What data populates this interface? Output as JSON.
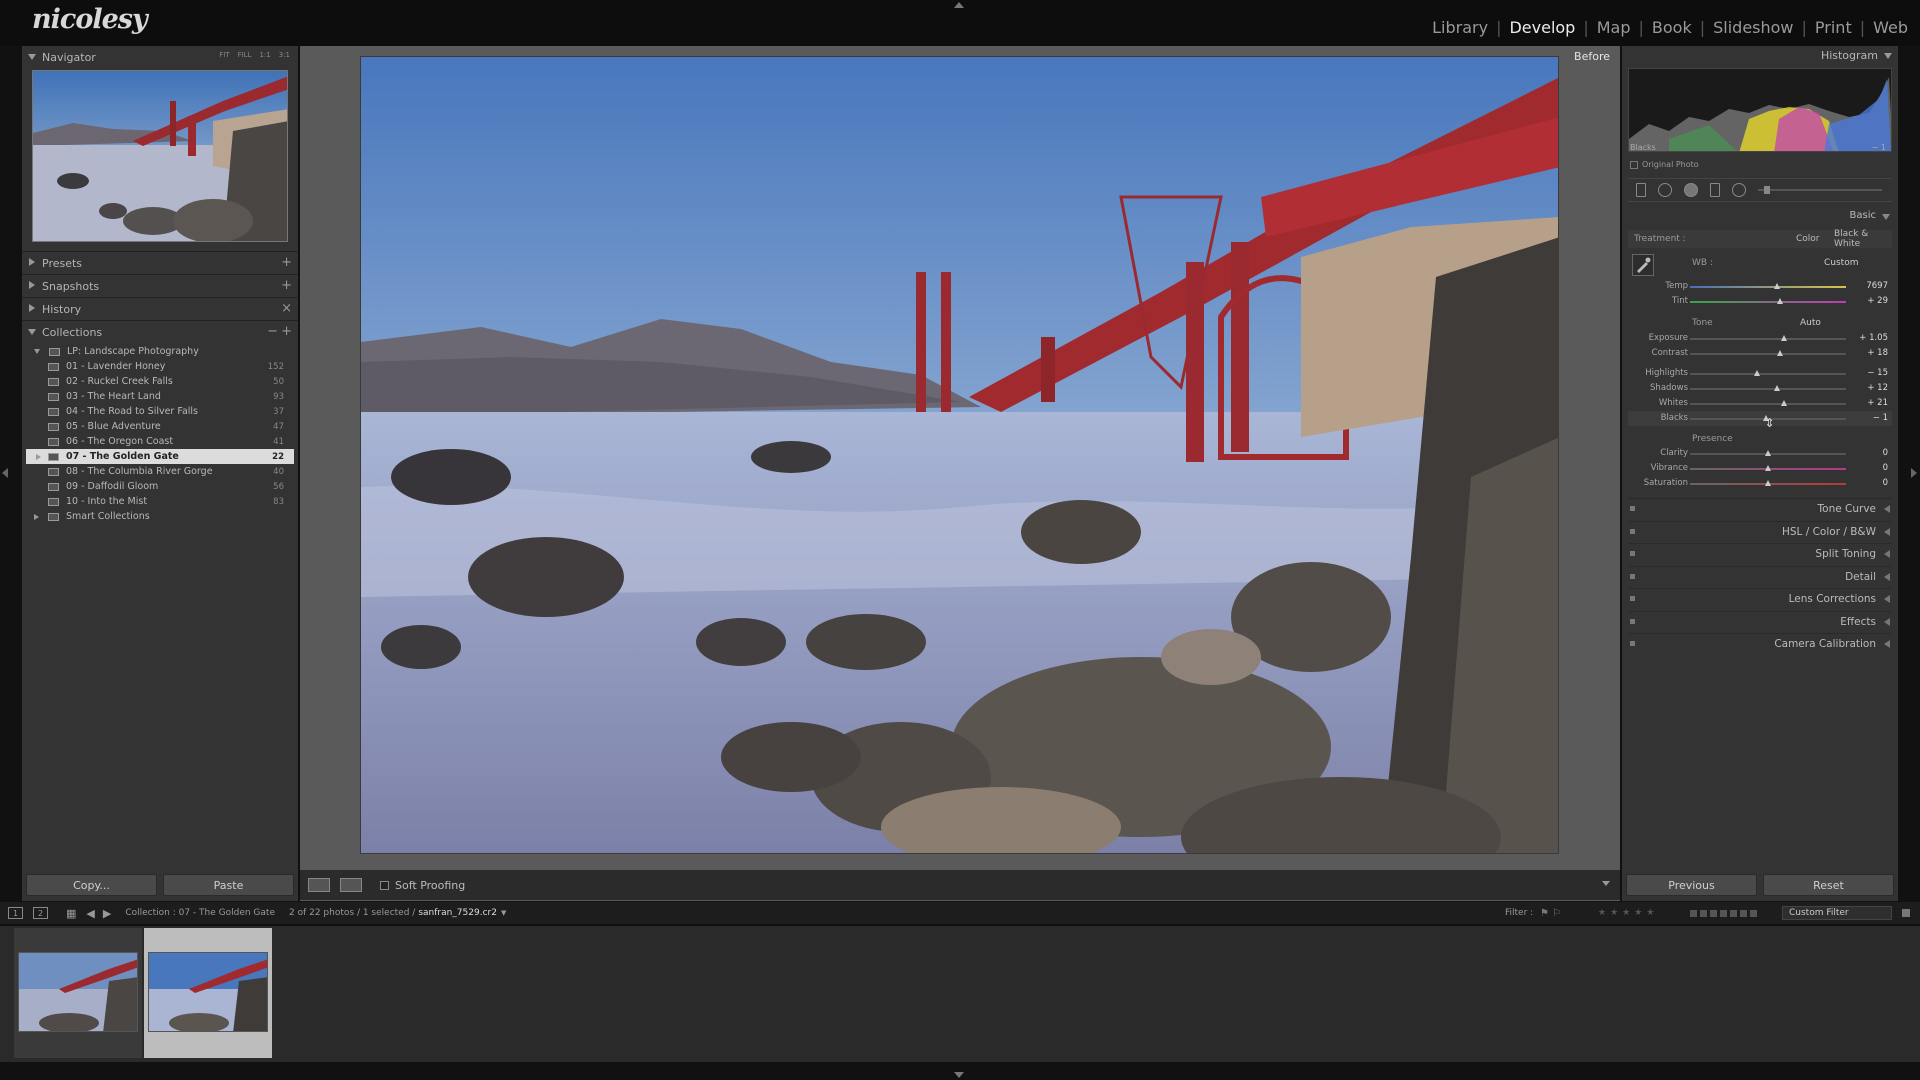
{
  "app": {
    "logo": "nicolesy",
    "modules": [
      {
        "label": "Library",
        "active": false
      },
      {
        "label": "Develop",
        "active": true
      },
      {
        "label": "Map",
        "active": false
      },
      {
        "label": "Book",
        "active": false
      },
      {
        "label": "Slideshow",
        "active": false
      },
      {
        "label": "Print",
        "active": false
      },
      {
        "label": "Web",
        "active": false
      }
    ],
    "separator": "|"
  },
  "left": {
    "navigator": {
      "title": "Navigator",
      "modes": [
        "FIT",
        "FILL",
        "1:1",
        "3:1"
      ]
    },
    "presets": {
      "title": "Presets",
      "action": "+"
    },
    "snapshots": {
      "title": "Snapshots",
      "action": "+"
    },
    "history": {
      "title": "History",
      "action": "×"
    },
    "collections": {
      "title": "Collections",
      "actions": [
        "−",
        "+"
      ],
      "set": "LP: Landscape Photography",
      "items": [
        {
          "label": "01 - Lavender Honey",
          "count": "152"
        },
        {
          "label": "02 - Ruckel Creek Falls",
          "count": "50"
        },
        {
          "label": "03 - The Heart Land",
          "count": "93"
        },
        {
          "label": "04 - The Road to Silver Falls",
          "count": "37"
        },
        {
          "label": "05 - Blue Adventure",
          "count": "47"
        },
        {
          "label": "06 - The Oregon Coast",
          "count": "41"
        },
        {
          "label": "07 - The Golden Gate",
          "count": "22"
        },
        {
          "label": "08 - The Columbia River Gorge",
          "count": "40"
        },
        {
          "label": "09 - Daffodil Gloom",
          "count": "56"
        },
        {
          "label": "10 - Into the Mist",
          "count": "83"
        }
      ],
      "selected_index": 6,
      "smart": "Smart Collections"
    },
    "copy_label": "Copy...",
    "paste_label": "Paste"
  },
  "center": {
    "before_label": "Before",
    "soft_proofing": "Soft Proofing"
  },
  "right": {
    "histogram": {
      "title": "Histogram",
      "channel_label": "Blacks",
      "channel_value": "− 1",
      "original_photo": "Original Photo"
    },
    "basic": {
      "title": "Basic",
      "treatment_label": "Treatment :",
      "treatment_color": "Color",
      "treatment_bw": "Black & White",
      "wb_label": "WB :",
      "wb_value": "Custom",
      "tone_label": "Tone",
      "auto_label": "Auto",
      "presence_label": "Presence",
      "sliders": [
        {
          "label": "Temp",
          "value": "7697",
          "pos": 0.56
        },
        {
          "label": "Tint",
          "value": "+ 29",
          "pos": 0.58
        },
        {
          "label": "Exposure",
          "value": "+ 1.05",
          "pos": 0.6
        },
        {
          "label": "Contrast",
          "value": "+ 18",
          "pos": 0.58
        },
        {
          "label": "Highlights",
          "value": "− 15",
          "pos": 0.43
        },
        {
          "label": "Shadows",
          "value": "+ 12",
          "pos": 0.56
        },
        {
          "label": "Whites",
          "value": "+ 21",
          "pos": 0.6
        },
        {
          "label": "Blacks",
          "value": "− 1",
          "pos": 0.49
        },
        {
          "label": "Clarity",
          "value": "0",
          "pos": 0.5
        },
        {
          "label": "Vibrance",
          "value": "0",
          "pos": 0.5
        },
        {
          "label": "Saturation",
          "value": "0",
          "pos": 0.5
        }
      ]
    },
    "panels": [
      "Tone Curve",
      "HSL / Color / B&W",
      "Split Toning",
      "Detail",
      "Lens Corrections",
      "Effects",
      "Camera Calibration"
    ],
    "previous_label": "Previous",
    "reset_label": "Reset"
  },
  "filmstrip": {
    "screen1": "1",
    "screen2": "2",
    "collection_path": "Collection : 07 - The Golden Gate",
    "photo_count": "2 of 22 photos / 1 selected /",
    "filename": "sanfran_7529.cr2",
    "filter_label": "Filter :",
    "filter_value": "Custom Filter"
  },
  "colors": {
    "accent": "#dcdcdc",
    "panel_bg": "#333333",
    "bridge_red": "#a12a2f",
    "sky_top": "#4d7dbf"
  }
}
